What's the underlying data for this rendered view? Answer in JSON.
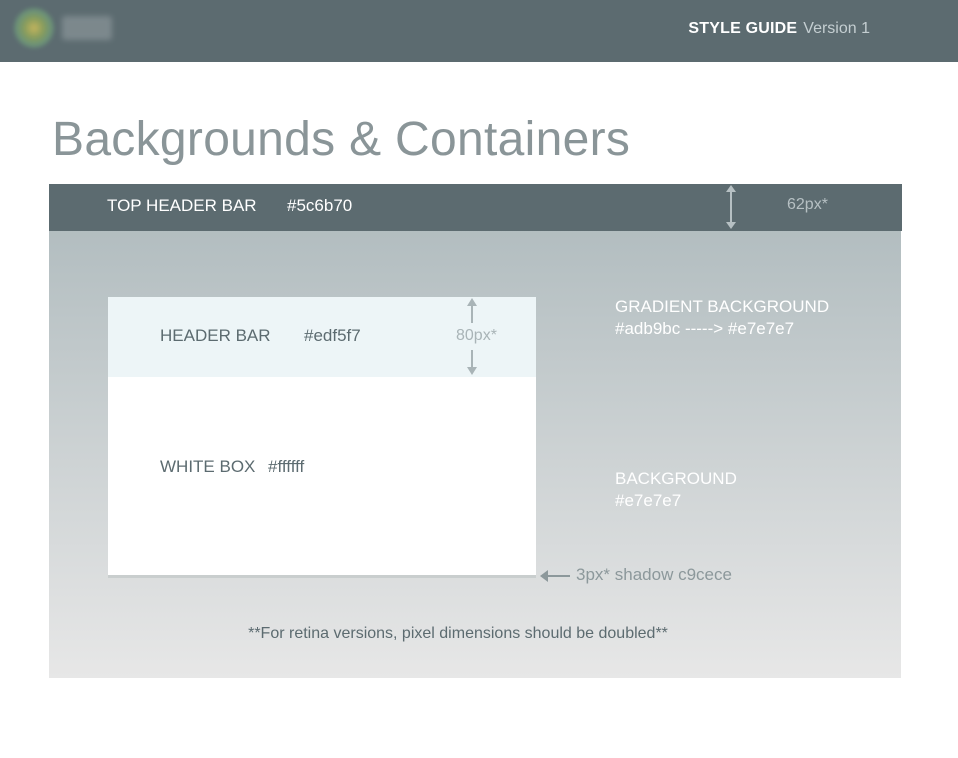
{
  "topbar": {
    "title": "STYLE GUIDE",
    "version": "Version 1"
  },
  "page": {
    "title": "Backgrounds & Containers"
  },
  "top_header_bar": {
    "label": "TOP HEADER BAR",
    "color": "#5c6b70",
    "height_label": "62px*"
  },
  "header_bar": {
    "label": "HEADER BAR",
    "color": "#edf5f7",
    "height_label": "80px*"
  },
  "white_box": {
    "label": "WHITE BOX",
    "color": "#ffffff"
  },
  "gradient_background": {
    "label": "GRADIENT BACKGROUND",
    "value": "#adb9bc -----> #e7e7e7"
  },
  "background": {
    "label": "BACKGROUND",
    "value": "#e7e7e7"
  },
  "shadow": {
    "label": "3px* shadow c9cece"
  },
  "footnote": "**For retina versions, pixel dimensions should be doubled**",
  "colors": {
    "top_header": "#5c6b70",
    "header_bar": "#edf5f7",
    "white_box": "#ffffff",
    "gradient_start": "#adb9bc",
    "gradient_end": "#e7e7e7",
    "shadow": "#c9cece"
  }
}
